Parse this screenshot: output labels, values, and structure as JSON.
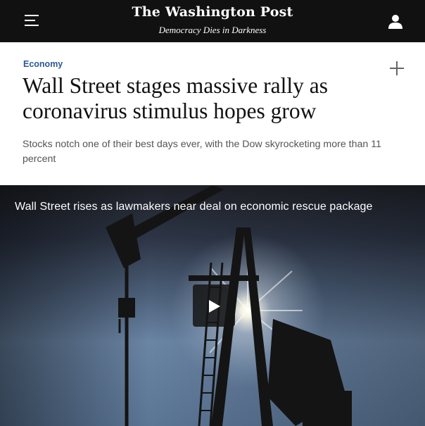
{
  "header": {
    "masthead": "The Washington Post",
    "tagline": "Democracy Dies in Darkness",
    "menu_icon": "hamburger-menu-icon",
    "account_icon": "user-icon"
  },
  "article": {
    "section": "Economy",
    "headline": "Wall Street stages massive rally as coronavirus stimulus hopes grow",
    "dek": "Stocks notch one of their best days ever, with the Dow skyrocketing more than 11 percent",
    "save_icon": "plus-icon"
  },
  "video": {
    "title": "Wall Street rises as lawmakers near deal on economic rescue package",
    "play_icon": "play-icon"
  },
  "colors": {
    "header_bg": "#111111",
    "section_accent": "#2a5a97"
  }
}
